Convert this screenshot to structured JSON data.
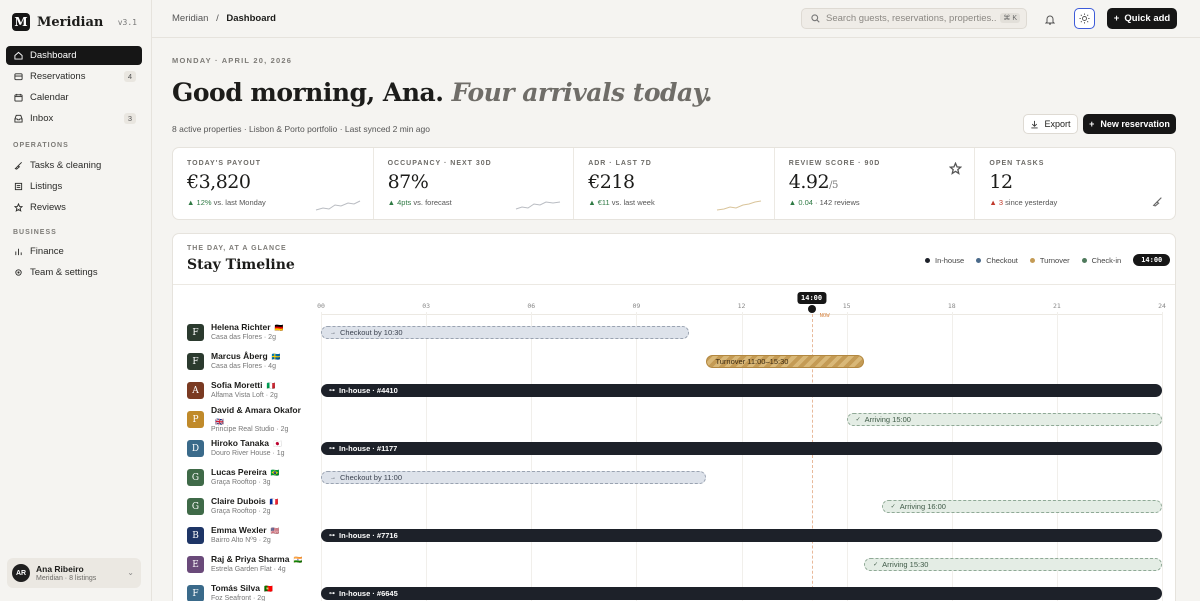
{
  "app": {
    "name": "Meridian",
    "logo_letter": "M",
    "version": "v3.1"
  },
  "sidebar": {
    "main_items": [
      {
        "label": "Dashboard",
        "icon": "home-icon",
        "active": true
      },
      {
        "label": "Reservations",
        "icon": "reservations-icon",
        "badge": "4"
      },
      {
        "label": "Calendar",
        "icon": "calendar-icon"
      },
      {
        "label": "Inbox",
        "icon": "inbox-icon",
        "badge": "3"
      }
    ],
    "section_operations": "OPERATIONS",
    "operations_items": [
      {
        "label": "Tasks & cleaning",
        "icon": "broom-icon"
      },
      {
        "label": "Listings",
        "icon": "listings-icon"
      },
      {
        "label": "Reviews",
        "icon": "star-icon"
      }
    ],
    "section_business": "BUSINESS",
    "business_items": [
      {
        "label": "Finance",
        "icon": "chart-icon"
      },
      {
        "label": "Team & settings",
        "icon": "gear-icon"
      }
    ],
    "user": {
      "initials": "AR",
      "name": "Ana Ribeiro",
      "sub": "Meridian · 8 listings"
    }
  },
  "topbar": {
    "breadcrumb_root": "Meridian",
    "breadcrumb_sep": "/",
    "breadcrumb_current": "Dashboard",
    "search_placeholder": "Search guests, reservations, properties...",
    "search_shortcut": "⌘ K",
    "quick_add": "Quick add"
  },
  "header": {
    "date": "MONDAY · APRIL 20, 2026",
    "greeting": "Good morning, Ana.",
    "greeting_accent": "Four arrivals today.",
    "subline": "8 active properties · Lisbon & Porto portfolio · Last synced 2 min ago",
    "export": "Export",
    "new_reservation": "New reservation"
  },
  "kpis": [
    {
      "label": "TODAY'S PAYOUT",
      "value": "€3,820",
      "unit": "",
      "delta_mark": "▲",
      "delta": "12%",
      "delta_note": "vs. last Monday",
      "tone": "up",
      "spark": true
    },
    {
      "label": "OCCUPANCY · NEXT 30D",
      "value": "87%",
      "unit": "",
      "delta_mark": "▲",
      "delta": "4pts",
      "delta_note": "vs. forecast",
      "tone": "up",
      "spark": true
    },
    {
      "label": "ADR · LAST 7D",
      "value": "€218",
      "unit": "",
      "delta_mark": "▲",
      "delta": "€11",
      "delta_note": "vs. last week",
      "tone": "up",
      "spark": true
    },
    {
      "label": "REVIEW SCORE · 90D",
      "value": "4.92",
      "unit": "/5",
      "delta_mark": "▲",
      "delta": "0.04",
      "delta_note": "· 142 reviews",
      "tone": "up",
      "icon": "star-icon"
    },
    {
      "label": "OPEN TASKS",
      "value": "12",
      "unit": "",
      "delta_mark": "▲",
      "delta": "3",
      "delta_note": "since yesterday",
      "tone": "warn",
      "icon": "broom-icon"
    }
  ],
  "timeline": {
    "eyebrow": "THE DAY, AT A GLANCE",
    "title": "Stay Timeline",
    "legend": [
      {
        "label": "In-house",
        "color": "#1d2129"
      },
      {
        "label": "Checkout",
        "color": "#4a6a8a"
      },
      {
        "label": "Turnover",
        "color": "#c49b55"
      },
      {
        "label": "Check-in",
        "color": "#4f7a5c"
      }
    ],
    "current_time": "14:00",
    "now_chip": "14:00",
    "now_sub": "NOW",
    "hours": [
      "00",
      "03",
      "06",
      "09",
      "12",
      "15",
      "18",
      "21",
      "24"
    ],
    "rows": [
      {
        "initial": "F",
        "color": "#2b3a2e",
        "name": "Helena Richter",
        "flag": "🇩🇪",
        "sub": "Casa das Flores · 2g",
        "bar_type": "checkout",
        "bar_label": "Checkout by 10:30",
        "start": 0,
        "end": 10.5,
        "bar_icon": "→"
      },
      {
        "initial": "F",
        "color": "#2b3a2e",
        "name": "Marcus Åberg",
        "flag": "🇸🇪",
        "sub": "Casa das Flores · 4g",
        "bar_type": "turnover",
        "bar_label": "Turnover 11:00–15:30",
        "start": 11,
        "end": 15.5,
        "bar_icon": ""
      },
      {
        "initial": "A",
        "color": "#7a3a22",
        "name": "Sofia Moretti",
        "flag": "🇮🇹",
        "sub": "Alfama Vista Loft · 2g",
        "bar_type": "inhouse",
        "bar_label": "In-house · #4410",
        "start": 0,
        "end": 24,
        "bar_icon": "⊶"
      },
      {
        "initial": "P",
        "color": "#c08a2a",
        "name": "David & Amara Okafor",
        "flag": "🇬🇧",
        "sub": "Principe Real Studio · 2g",
        "bar_type": "arriving",
        "bar_label": "Arriving 15:00",
        "start": 15,
        "end": 24,
        "bar_icon": "✓",
        "two_line": true
      },
      {
        "initial": "D",
        "color": "#3a6a8a",
        "name": "Hiroko Tanaka",
        "flag": "🇯🇵",
        "sub": "Douro River House · 1g",
        "bar_type": "inhouse",
        "bar_label": "In-house · #1177",
        "start": 0,
        "end": 24,
        "bar_icon": "⊶"
      },
      {
        "initial": "G",
        "color": "#3f6a48",
        "name": "Lucas Pereira",
        "flag": "🇧🇷",
        "sub": "Graça Rooftop · 3g",
        "bar_type": "checkout",
        "bar_label": "Checkout by 11:00",
        "start": 0,
        "end": 11,
        "bar_icon": "→"
      },
      {
        "initial": "G",
        "color": "#3f6a48",
        "name": "Claire Dubois",
        "flag": "🇫🇷",
        "sub": "Graça Rooftop · 2g",
        "bar_type": "arriving",
        "bar_label": "Arriving 16:00",
        "start": 16,
        "end": 24,
        "bar_icon": "✓"
      },
      {
        "initial": "B",
        "color": "#1e3566",
        "name": "Emma Wexler",
        "flag": "🇺🇸",
        "sub": "Bairro Alto Nº9 · 2g",
        "bar_type": "inhouse",
        "bar_label": "In-house · #7716",
        "start": 0,
        "end": 24,
        "bar_icon": "⊶"
      },
      {
        "initial": "E",
        "color": "#6a4a7a",
        "name": "Raj & Priya Sharma",
        "flag": "🇮🇳",
        "sub": "Estrela Garden Flat · 4g",
        "bar_type": "arriving",
        "bar_label": "Arriving 15:30",
        "start": 15.5,
        "end": 24,
        "bar_icon": "✓"
      },
      {
        "initial": "F",
        "color": "#3a6a8a",
        "name": "Tomás Silva",
        "flag": "🇵🇹",
        "sub": "Foz Seafront · 2g",
        "bar_type": "inhouse",
        "bar_label": "In-house · #6645",
        "start": 0,
        "end": 24,
        "bar_icon": "⊶"
      }
    ]
  }
}
